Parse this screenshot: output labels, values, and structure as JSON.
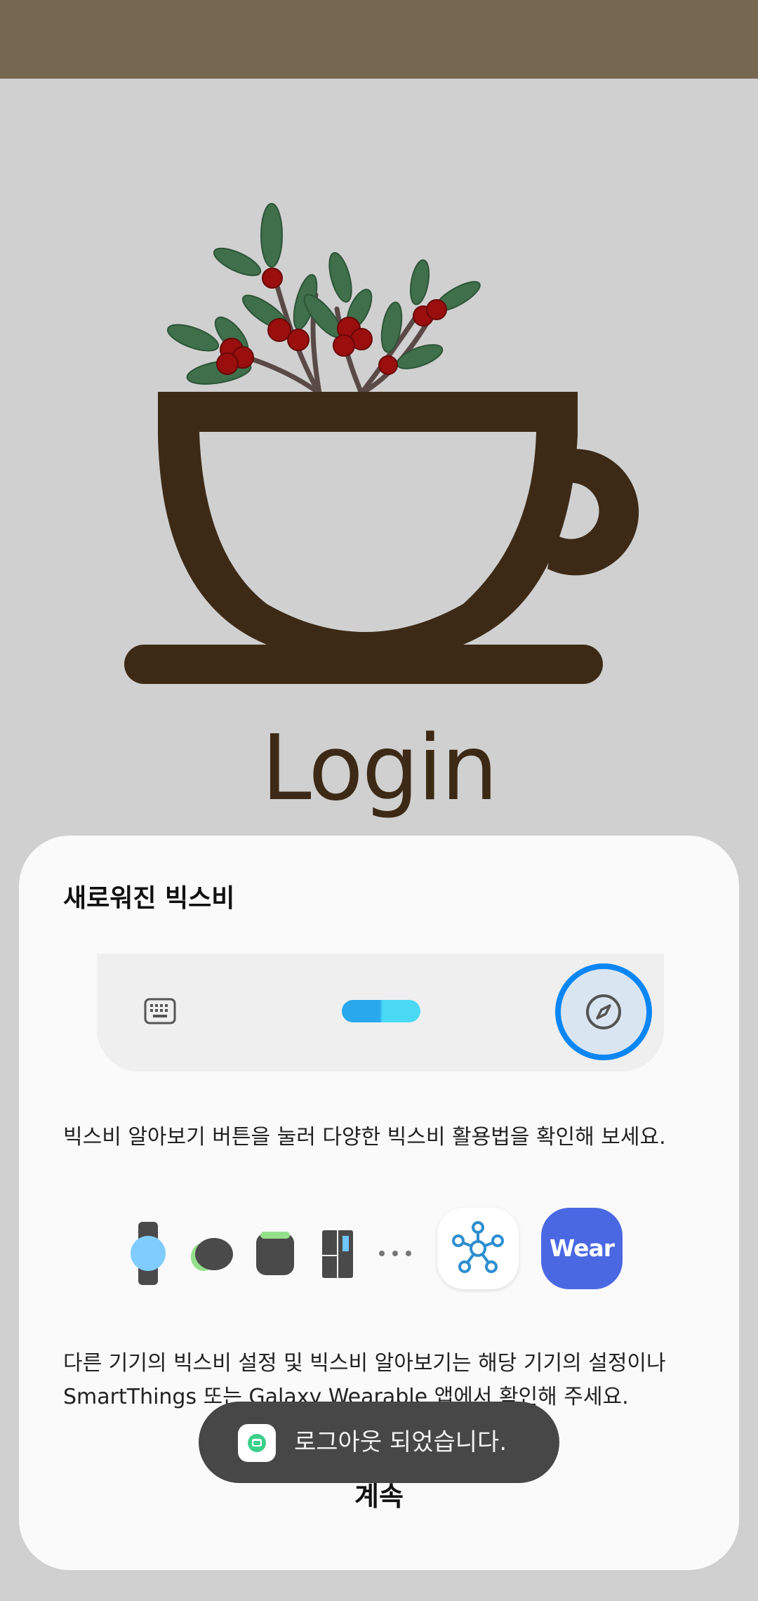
{
  "status_bar": {
    "color": "#766850"
  },
  "screen": {
    "title": "Login",
    "illustration": "coffee-cup-with-berry-branches-icon"
  },
  "bixby_sheet": {
    "title": "새로워진 빅스비",
    "preview": {
      "keyboard_icon": "keyboard-icon",
      "handle": "bixby-handle-pill",
      "explore_icon": "compass-icon"
    },
    "description1": "빅스비 알아보기 버튼을 눌러 다양한 빅스비 활용법을 확인해 보세요.",
    "devices": [
      "watch-icon",
      "buds-icon",
      "speaker-icon",
      "fridge-icon",
      "more-icon"
    ],
    "apps": [
      {
        "name": "smartthings-icon"
      },
      {
        "name": "wear-icon",
        "label": "Wear"
      }
    ],
    "description2": "다른 기기의 빅스비 설정 및 빅스비 알아보기는 해당 기기의 설정이나 SmartThings 또는 Galaxy Wearable 앱에서 확인해 주세요.",
    "continue_label": "계속"
  },
  "toast": {
    "text": "로그아웃 되었습니다.",
    "icon": "app-icon"
  },
  "colors": {
    "background": "#d0d0d0",
    "cup_brown": "#3d2a16",
    "accent_blue": "#0a86f5",
    "wear_blue": "#4b68e3"
  }
}
